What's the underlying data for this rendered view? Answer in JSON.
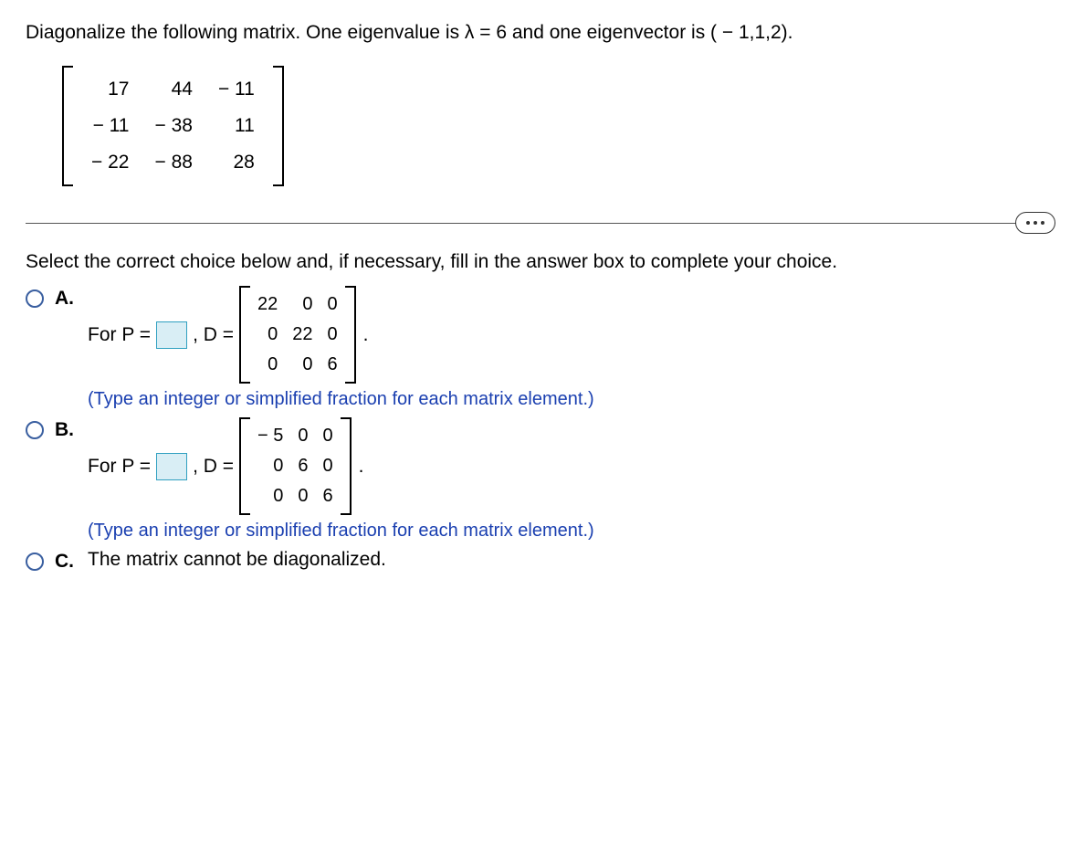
{
  "question": "Diagonalize the following matrix. One eigenvalue is λ = 6 and one eigenvector is ( − 1,1,2).",
  "matrix": [
    [
      "17",
      "44",
      "− 11"
    ],
    [
      "− 11",
      "− 38",
      "11"
    ],
    [
      "− 22",
      "− 88",
      "28"
    ]
  ],
  "prompt": "Select the correct choice below and, if necessary, fill in the answer box to complete your choice.",
  "choices": {
    "a": {
      "label": "A.",
      "pre": "For P =",
      "mid": ", D =",
      "dmatrix": [
        [
          "22",
          "0",
          "0"
        ],
        [
          "0",
          "22",
          "0"
        ],
        [
          "0",
          "0",
          "6"
        ]
      ],
      "period": ".",
      "hint": "(Type an integer or simplified fraction for each matrix element.)"
    },
    "b": {
      "label": "B.",
      "pre": "For P =",
      "mid": ", D =",
      "dmatrix": [
        [
          "− 5",
          "0",
          "0"
        ],
        [
          "0",
          "6",
          "0"
        ],
        [
          "0",
          "0",
          "6"
        ]
      ],
      "period": ".",
      "hint": "(Type an integer or simplified fraction for each matrix element.)"
    },
    "c": {
      "label": "C.",
      "text": "The matrix cannot be diagonalized."
    }
  },
  "chart_data": {
    "type": "table",
    "title": "Given 3x3 matrix",
    "values": [
      [
        17,
        44,
        -11
      ],
      [
        -11,
        -38,
        11
      ],
      [
        -22,
        -88,
        28
      ]
    ],
    "given_eigenvalue": 6,
    "given_eigenvector": [
      -1,
      1,
      2
    ],
    "choice_A_D": [
      [
        22,
        0,
        0
      ],
      [
        0,
        22,
        0
      ],
      [
        0,
        0,
        6
      ]
    ],
    "choice_B_D": [
      [
        -5,
        0,
        0
      ],
      [
        0,
        6,
        0
      ],
      [
        0,
        0,
        6
      ]
    ]
  }
}
